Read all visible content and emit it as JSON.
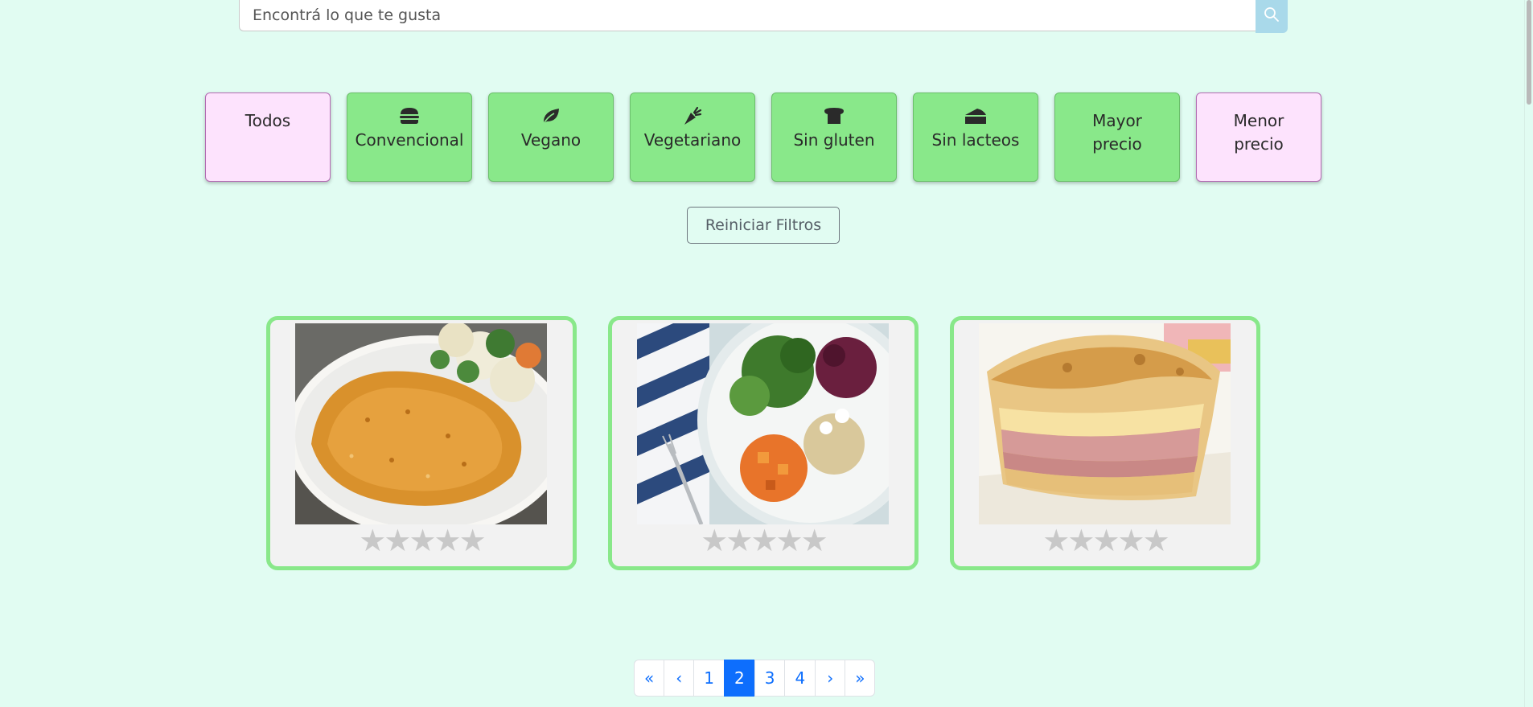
{
  "search": {
    "placeholder": "Encontrá lo que te gusta"
  },
  "filters": [
    {
      "label": "Todos",
      "icon": "",
      "style": "pink"
    },
    {
      "label": "Convencional",
      "icon": "burger-icon",
      "style": "green"
    },
    {
      "label": "Vegano",
      "icon": "leaf-icon",
      "style": "green"
    },
    {
      "label": "Vegetariano",
      "icon": "carrot-icon",
      "style": "green"
    },
    {
      "label": "Sin gluten",
      "icon": "bread-icon",
      "style": "green"
    },
    {
      "label": "Sin lacteos",
      "icon": "cheese-icon",
      "style": "green"
    },
    {
      "label": "Mayor precio",
      "icon": "",
      "style": "green"
    },
    {
      "label": "Menor precio",
      "icon": "",
      "style": "pink"
    }
  ],
  "reset_label": "Reiniciar Filtros",
  "products": [
    {
      "image": "milanesa-with-vegetables",
      "rating": 0,
      "max_rating": 5
    },
    {
      "image": "salad-bowl",
      "rating": 0,
      "max_rating": 5
    },
    {
      "image": "ham-cheese-pie",
      "rating": 0,
      "max_rating": 5
    }
  ],
  "pagination": {
    "first": "«",
    "prev": "‹",
    "pages": [
      "1",
      "2",
      "3",
      "4"
    ],
    "current": "2",
    "next": "›",
    "last": "»"
  },
  "colors": {
    "background": "#e1fcf2",
    "filter_green": "#89e88a",
    "filter_pink": "#fde3fd",
    "card_border": "#89e88a",
    "pagination_active": "#0d6efd"
  }
}
